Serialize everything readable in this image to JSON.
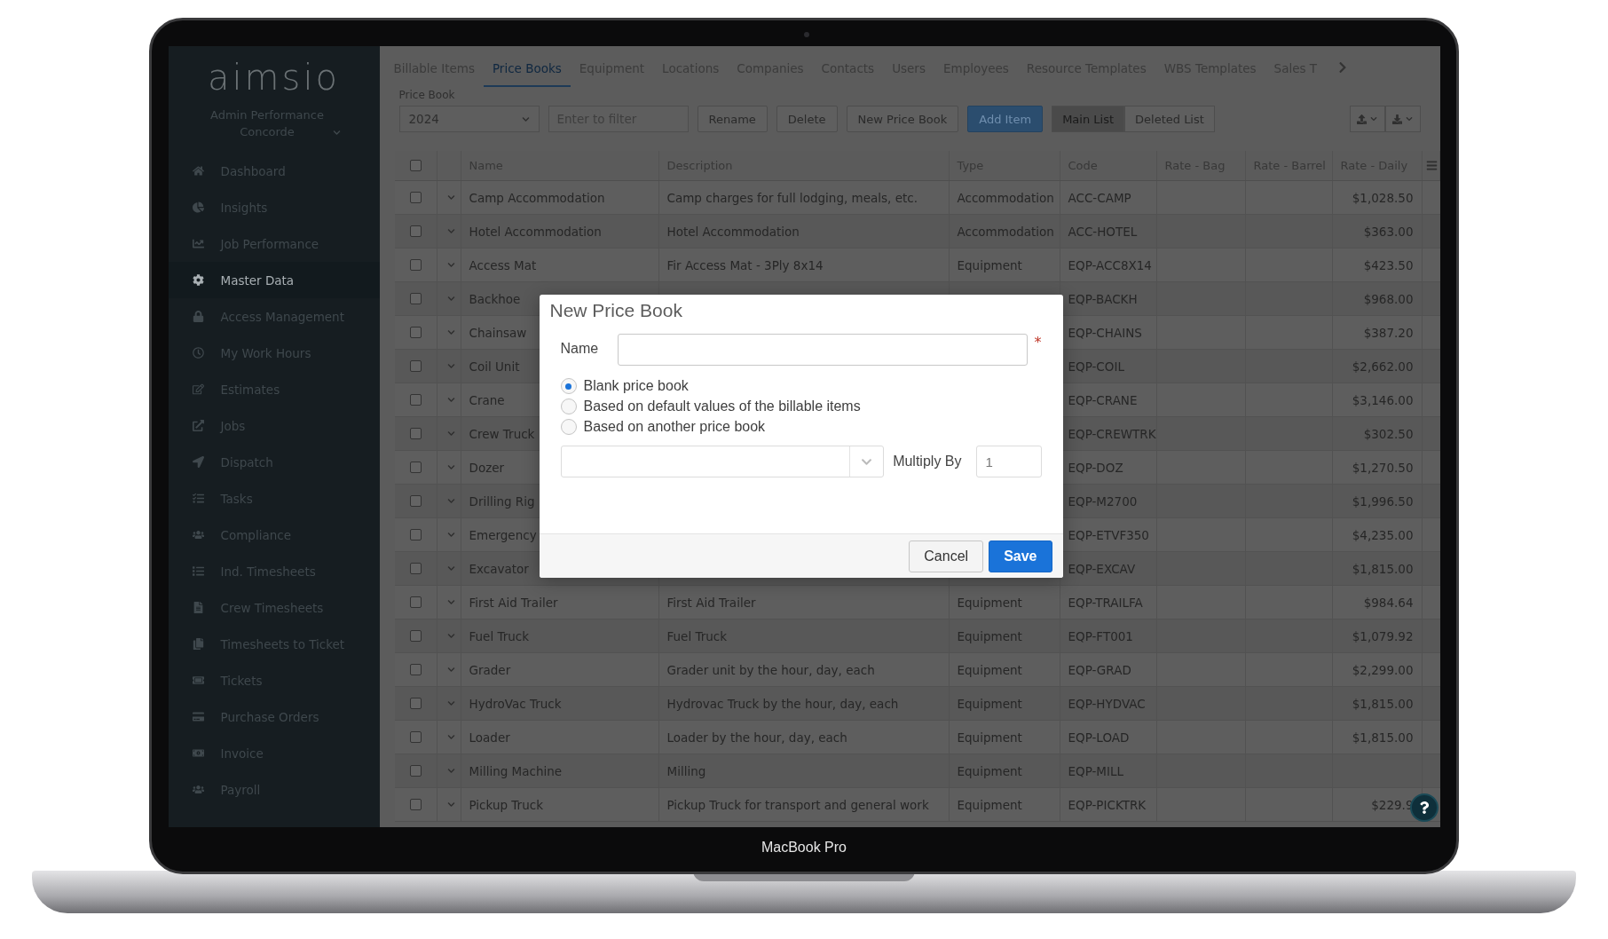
{
  "sidebar": {
    "logo": "aimsio",
    "account": "Admin Performance Concorde",
    "items": [
      {
        "label": "Dashboard",
        "selected": false
      },
      {
        "label": "Insights",
        "selected": false
      },
      {
        "label": "Job Performance",
        "selected": false
      },
      {
        "label": "Master Data",
        "selected": true
      },
      {
        "label": "Access Management",
        "selected": false
      },
      {
        "label": "My Work Hours",
        "selected": false
      },
      {
        "label": "Estimates",
        "selected": false
      },
      {
        "label": "Jobs",
        "selected": false
      },
      {
        "label": "Dispatch",
        "selected": false
      },
      {
        "label": "Tasks",
        "selected": false
      },
      {
        "label": "Compliance",
        "selected": false
      },
      {
        "label": "Ind. Timesheets",
        "selected": false
      },
      {
        "label": "Crew Timesheets",
        "selected": false
      },
      {
        "label": "Timesheets to Ticket",
        "selected": false
      },
      {
        "label": "Tickets",
        "selected": false
      },
      {
        "label": "Purchase Orders",
        "selected": false
      },
      {
        "label": "Invoice",
        "selected": false
      },
      {
        "label": "Payroll",
        "selected": false
      }
    ]
  },
  "tabs": [
    {
      "label": "Billable Items",
      "selected": false
    },
    {
      "label": "Price Books",
      "selected": true
    },
    {
      "label": "Equipment",
      "selected": false
    },
    {
      "label": "Locations",
      "selected": false
    },
    {
      "label": "Companies",
      "selected": false
    },
    {
      "label": "Contacts",
      "selected": false
    },
    {
      "label": "Users",
      "selected": false
    },
    {
      "label": "Employees",
      "selected": false
    },
    {
      "label": "Resource Templates",
      "selected": false
    },
    {
      "label": "WBS Templates",
      "selected": false
    },
    {
      "label": "Sales T",
      "selected": false
    }
  ],
  "toolbar": {
    "price_book_label": "Price Book",
    "price_book_value": "2024",
    "filter_placeholder": "Enter to filter",
    "buttons": [
      {
        "label": "Rename",
        "kind": "default"
      },
      {
        "label": "Delete",
        "kind": "default"
      },
      {
        "label": "New Price Book",
        "kind": "default"
      },
      {
        "label": "Add Item",
        "kind": "primary"
      }
    ],
    "list_toggle": [
      {
        "label": "Main List",
        "selected": true
      },
      {
        "label": "Deleted List",
        "selected": false
      }
    ]
  },
  "table": {
    "header_checked": false,
    "columns": [
      "Name",
      "Description",
      "Type",
      "Code",
      "Rate - Bag",
      "Rate - Barrel",
      "Rate - Daily"
    ],
    "rows": [
      {
        "checked": false,
        "name": "Camp Accommodation",
        "description": "Camp charges for full lodging, meals, etc.",
        "type": "Accommodation",
        "code": "ACC-CAMP",
        "rate_daily": "$1,028.50"
      },
      {
        "checked": false,
        "name": "Hotel Accommodation",
        "description": "Hotel Accommodation",
        "type": "Accommodation",
        "code": "ACC-HOTEL",
        "rate_daily": "$363.00"
      },
      {
        "checked": false,
        "name": "Access Mat",
        "description": "Fir Access Mat - 3Ply 8x14",
        "type": "Equipment",
        "code": "EQP-ACC8X14",
        "rate_daily": "$423.50"
      },
      {
        "checked": false,
        "name": "Backhoe",
        "code": "EQP-BACKH",
        "rate_daily": "$968.00"
      },
      {
        "checked": false,
        "name": "Chainsaw",
        "code": "EQP-CHAINS",
        "rate_daily": "$387.20"
      },
      {
        "checked": false,
        "name": "Coil Unit",
        "code": "EQP-COIL",
        "rate_daily": "$2,662.00"
      },
      {
        "checked": false,
        "name": "Crane",
        "code": "EQP-CRANE",
        "rate_daily": "$3,146.00"
      },
      {
        "checked": false,
        "name": "Crew Truck",
        "code": "EQP-CREWTRK",
        "rate_daily": "$302.50"
      },
      {
        "checked": false,
        "name": "Dozer",
        "code": "EQP-DOZ",
        "rate_daily": "$1,270.50"
      },
      {
        "checked": false,
        "name": "Drilling Rig",
        "code": "EQP-M2700",
        "rate_daily": "$1,996.50"
      },
      {
        "checked": false,
        "name": "Emergency",
        "code": "EQP-ETVF350",
        "rate_daily": "$4,235.00"
      },
      {
        "checked": false,
        "name": "Excavator",
        "code": "EQP-EXCAV",
        "rate_daily": "$1,815.00"
      },
      {
        "checked": false,
        "name": "First Aid Trailer",
        "description": "First Aid Trailer",
        "type": "Equipment",
        "code": "EQP-TRAILFA",
        "rate_daily": "$984.64"
      },
      {
        "checked": false,
        "name": "Fuel Truck",
        "description": "Fuel Truck",
        "type": "Equipment",
        "code": "EQP-FT001",
        "rate_daily": "$1,079.92"
      },
      {
        "checked": false,
        "name": "Grader",
        "description": "Grader unit by the hour, day, each",
        "type": "Equipment",
        "code": "EQP-GRAD",
        "rate_daily": "$2,299.00"
      },
      {
        "checked": false,
        "name": "HydroVac Truck",
        "description": "Hydrovac Truck by the hour, day, each",
        "type": "Equipment",
        "code": "EQP-HYDVAC",
        "rate_daily": "$1,815.00"
      },
      {
        "checked": false,
        "name": "Loader",
        "description": "Loader by the hour, day, each",
        "type": "Equipment",
        "code": "EQP-LOAD",
        "rate_daily": "$1,815.00"
      },
      {
        "checked": false,
        "name": "Milling Machine",
        "description": "Milling",
        "type": "Equipment",
        "code": "EQP-MILL"
      },
      {
        "checked": false,
        "name": "Pickup Truck",
        "description": "Pickup Truck for transport and general work",
        "type": "Equipment",
        "code": "EQP-PICKTRK",
        "rate_daily": "$229.9"
      }
    ]
  },
  "dialog": {
    "title": "New Price Book",
    "name_label": "Name",
    "required_mark": "*",
    "options": [
      {
        "label": "Blank price book",
        "selected": true
      },
      {
        "label": "Based on default values of the billable items",
        "selected": false
      },
      {
        "label": "Based on another price book",
        "selected": false
      }
    ],
    "multiply_label": "Multiply By",
    "multiply_value": "1",
    "buttons": [
      {
        "label": "Cancel",
        "kind": "default"
      },
      {
        "label": "Save",
        "kind": "primary"
      }
    ]
  },
  "device_label": "MacBook Pro"
}
